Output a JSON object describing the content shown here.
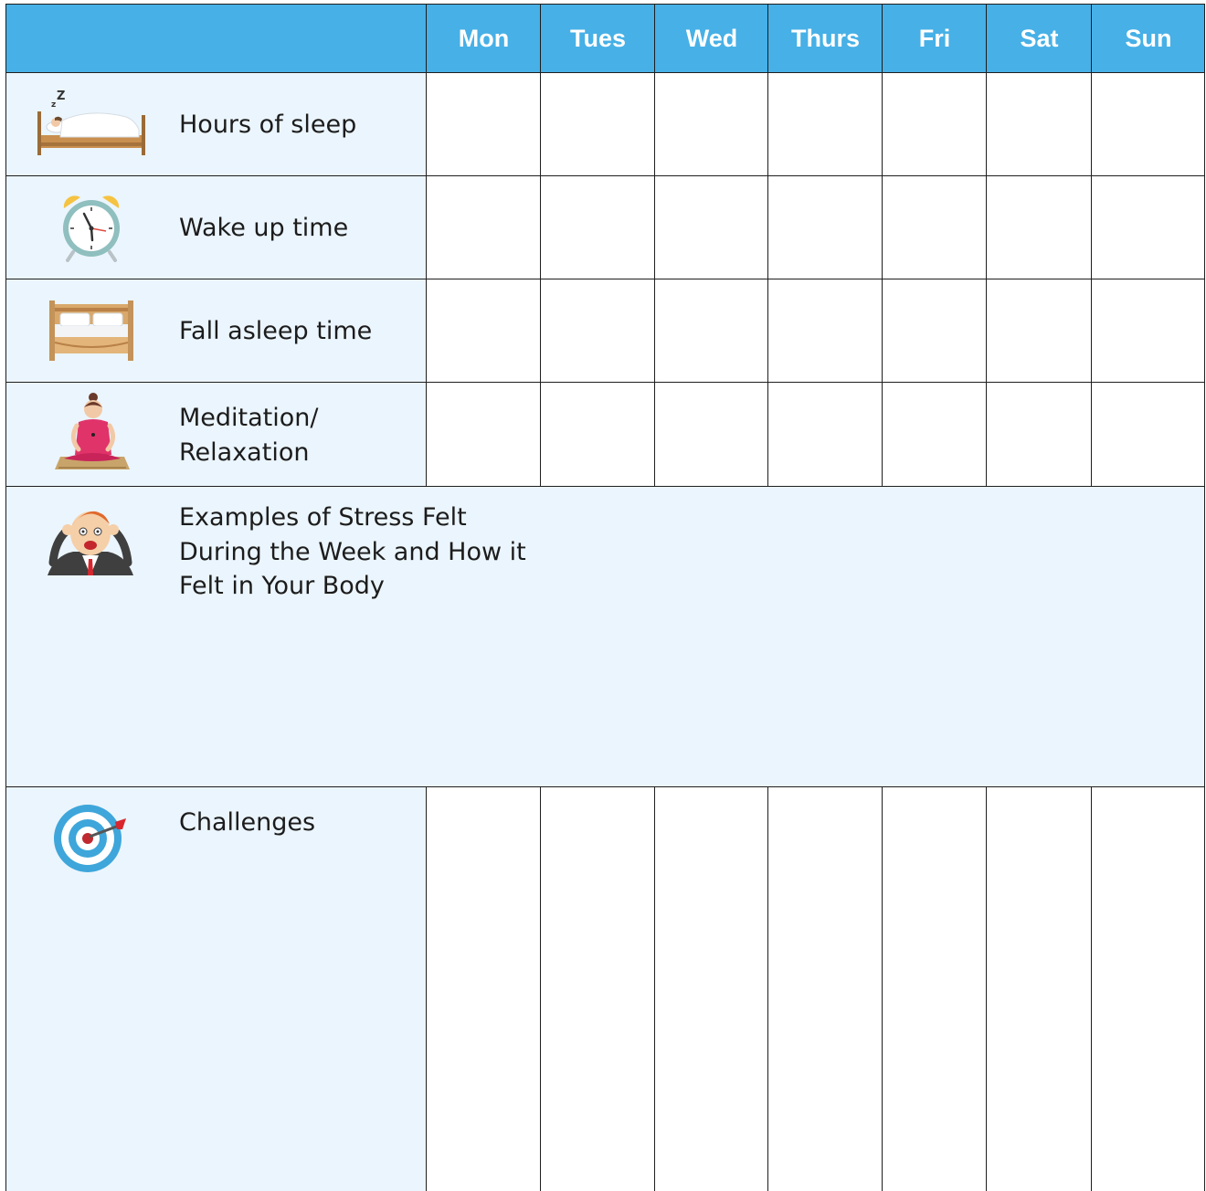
{
  "header": {
    "days": [
      "Mon",
      "Tues",
      "Wed",
      "Thurs",
      "Fri",
      "Sat",
      "Sun"
    ]
  },
  "rows": {
    "sleep_hours": {
      "label": "Hours of sleep",
      "icon": "sleeping-in-bed-icon"
    },
    "wake_time": {
      "label": "Wake up time",
      "icon": "alarm-clock-icon"
    },
    "fall_asleep_time": {
      "label": "Fall asleep time",
      "icon": "bed-icon"
    },
    "meditation": {
      "label_line1": "Meditation/",
      "label_line2": "Relaxation",
      "icon": "meditating-woman-icon"
    },
    "stress": {
      "label_line1": "Examples of Stress Felt",
      "label_line2": "During the Week and How it",
      "label_line3": "Felt in Your Body",
      "icon": "stressed-man-icon"
    },
    "challenges": {
      "label": "Challenges",
      "icon": "target-dart-icon"
    }
  },
  "colors": {
    "header_bg": "#47b0e6",
    "label_bg": "#ebf5fd",
    "border": "#1e1e1e"
  }
}
